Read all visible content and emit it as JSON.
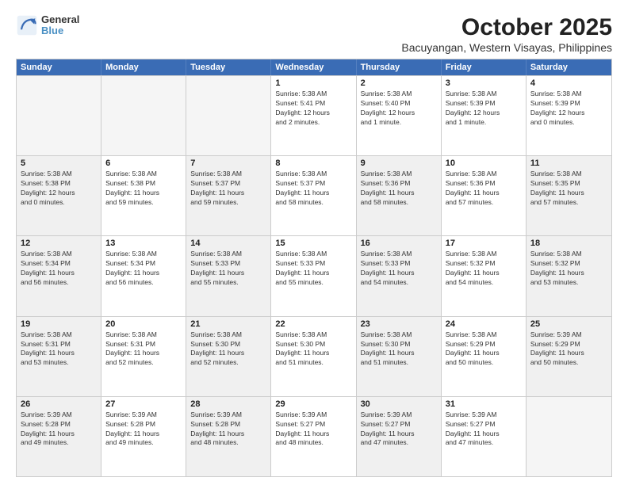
{
  "logo": {
    "line1": "General",
    "line2": "Blue"
  },
  "title": "October 2025",
  "subtitle": "Bacuyangan, Western Visayas, Philippines",
  "header": {
    "days": [
      "Sunday",
      "Monday",
      "Tuesday",
      "Wednesday",
      "Thursday",
      "Friday",
      "Saturday"
    ]
  },
  "weeks": [
    {
      "cells": [
        {
          "day": "",
          "info": "",
          "shaded": true
        },
        {
          "day": "",
          "info": "",
          "shaded": true
        },
        {
          "day": "",
          "info": "",
          "shaded": true
        },
        {
          "day": "1",
          "info": "Sunrise: 5:38 AM\nSunset: 5:41 PM\nDaylight: 12 hours\nand 2 minutes.",
          "shaded": false
        },
        {
          "day": "2",
          "info": "Sunrise: 5:38 AM\nSunset: 5:40 PM\nDaylight: 12 hours\nand 1 minute.",
          "shaded": false
        },
        {
          "day": "3",
          "info": "Sunrise: 5:38 AM\nSunset: 5:39 PM\nDaylight: 12 hours\nand 1 minute.",
          "shaded": false
        },
        {
          "day": "4",
          "info": "Sunrise: 5:38 AM\nSunset: 5:39 PM\nDaylight: 12 hours\nand 0 minutes.",
          "shaded": false
        }
      ]
    },
    {
      "cells": [
        {
          "day": "5",
          "info": "Sunrise: 5:38 AM\nSunset: 5:38 PM\nDaylight: 12 hours\nand 0 minutes.",
          "shaded": true
        },
        {
          "day": "6",
          "info": "Sunrise: 5:38 AM\nSunset: 5:38 PM\nDaylight: 11 hours\nand 59 minutes.",
          "shaded": false
        },
        {
          "day": "7",
          "info": "Sunrise: 5:38 AM\nSunset: 5:37 PM\nDaylight: 11 hours\nand 59 minutes.",
          "shaded": true
        },
        {
          "day": "8",
          "info": "Sunrise: 5:38 AM\nSunset: 5:37 PM\nDaylight: 11 hours\nand 58 minutes.",
          "shaded": false
        },
        {
          "day": "9",
          "info": "Sunrise: 5:38 AM\nSunset: 5:36 PM\nDaylight: 11 hours\nand 58 minutes.",
          "shaded": true
        },
        {
          "day": "10",
          "info": "Sunrise: 5:38 AM\nSunset: 5:36 PM\nDaylight: 11 hours\nand 57 minutes.",
          "shaded": false
        },
        {
          "day": "11",
          "info": "Sunrise: 5:38 AM\nSunset: 5:35 PM\nDaylight: 11 hours\nand 57 minutes.",
          "shaded": true
        }
      ]
    },
    {
      "cells": [
        {
          "day": "12",
          "info": "Sunrise: 5:38 AM\nSunset: 5:34 PM\nDaylight: 11 hours\nand 56 minutes.",
          "shaded": true
        },
        {
          "day": "13",
          "info": "Sunrise: 5:38 AM\nSunset: 5:34 PM\nDaylight: 11 hours\nand 56 minutes.",
          "shaded": false
        },
        {
          "day": "14",
          "info": "Sunrise: 5:38 AM\nSunset: 5:33 PM\nDaylight: 11 hours\nand 55 minutes.",
          "shaded": true
        },
        {
          "day": "15",
          "info": "Sunrise: 5:38 AM\nSunset: 5:33 PM\nDaylight: 11 hours\nand 55 minutes.",
          "shaded": false
        },
        {
          "day": "16",
          "info": "Sunrise: 5:38 AM\nSunset: 5:33 PM\nDaylight: 11 hours\nand 54 minutes.",
          "shaded": true
        },
        {
          "day": "17",
          "info": "Sunrise: 5:38 AM\nSunset: 5:32 PM\nDaylight: 11 hours\nand 54 minutes.",
          "shaded": false
        },
        {
          "day": "18",
          "info": "Sunrise: 5:38 AM\nSunset: 5:32 PM\nDaylight: 11 hours\nand 53 minutes.",
          "shaded": true
        }
      ]
    },
    {
      "cells": [
        {
          "day": "19",
          "info": "Sunrise: 5:38 AM\nSunset: 5:31 PM\nDaylight: 11 hours\nand 53 minutes.",
          "shaded": true
        },
        {
          "day": "20",
          "info": "Sunrise: 5:38 AM\nSunset: 5:31 PM\nDaylight: 11 hours\nand 52 minutes.",
          "shaded": false
        },
        {
          "day": "21",
          "info": "Sunrise: 5:38 AM\nSunset: 5:30 PM\nDaylight: 11 hours\nand 52 minutes.",
          "shaded": true
        },
        {
          "day": "22",
          "info": "Sunrise: 5:38 AM\nSunset: 5:30 PM\nDaylight: 11 hours\nand 51 minutes.",
          "shaded": false
        },
        {
          "day": "23",
          "info": "Sunrise: 5:38 AM\nSunset: 5:30 PM\nDaylight: 11 hours\nand 51 minutes.",
          "shaded": true
        },
        {
          "day": "24",
          "info": "Sunrise: 5:38 AM\nSunset: 5:29 PM\nDaylight: 11 hours\nand 50 minutes.",
          "shaded": false
        },
        {
          "day": "25",
          "info": "Sunrise: 5:39 AM\nSunset: 5:29 PM\nDaylight: 11 hours\nand 50 minutes.",
          "shaded": true
        }
      ]
    },
    {
      "cells": [
        {
          "day": "26",
          "info": "Sunrise: 5:39 AM\nSunset: 5:28 PM\nDaylight: 11 hours\nand 49 minutes.",
          "shaded": true
        },
        {
          "day": "27",
          "info": "Sunrise: 5:39 AM\nSunset: 5:28 PM\nDaylight: 11 hours\nand 49 minutes.",
          "shaded": false
        },
        {
          "day": "28",
          "info": "Sunrise: 5:39 AM\nSunset: 5:28 PM\nDaylight: 11 hours\nand 48 minutes.",
          "shaded": true
        },
        {
          "day": "29",
          "info": "Sunrise: 5:39 AM\nSunset: 5:27 PM\nDaylight: 11 hours\nand 48 minutes.",
          "shaded": false
        },
        {
          "day": "30",
          "info": "Sunrise: 5:39 AM\nSunset: 5:27 PM\nDaylight: 11 hours\nand 47 minutes.",
          "shaded": true
        },
        {
          "day": "31",
          "info": "Sunrise: 5:39 AM\nSunset: 5:27 PM\nDaylight: 11 hours\nand 47 minutes.",
          "shaded": false
        },
        {
          "day": "",
          "info": "",
          "shaded": true
        }
      ]
    }
  ]
}
